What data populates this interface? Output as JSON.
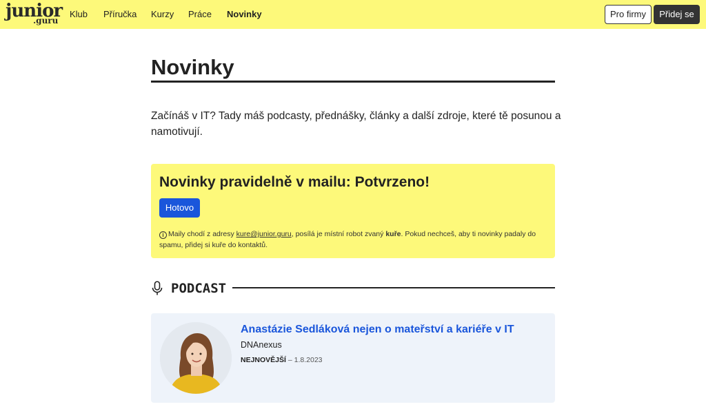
{
  "logo": {
    "line1": "junior",
    "line2": ".guru"
  },
  "nav": {
    "links": [
      "Klub",
      "Příručka",
      "Kurzy",
      "Práce",
      "Novinky"
    ],
    "active": "Novinky",
    "for_companies": "Pro firmy",
    "join": "Přidej se"
  },
  "page": {
    "title": "Novinky",
    "intro": "Začínáš v IT? Tady máš podcasty, přednášky, články a další zdroje, které tě posunou a namotivují."
  },
  "subscribe": {
    "heading": "Novinky pravidelně v mailu: Potvrzeno!",
    "button": "Hotovo",
    "note_icon": "i",
    "note_prefix": "Maily chodí z adresy ",
    "note_email": "kure@junior.guru",
    "note_mid": ", posílá je místní robot zvaný ",
    "note_bold": "kuře",
    "note_suffix": ". Pokud nechceš, aby ti novinky padaly do spamu, přidej si kuře do kontaktů."
  },
  "podcast": {
    "section_title": "PODCAST",
    "card": {
      "title": "Anastázie Sedláková nejen o mateřství a kariéře v IT",
      "subtitle": "DNAnexus",
      "badge": "NEJNOVĚJŠÍ",
      "date_sep": " – ",
      "date": "1.8.2023"
    }
  },
  "colors": {
    "nav_bg": "#fdf97a",
    "accent_blue": "#1a56db",
    "card_bg": "#eef3fa",
    "dark": "#333333"
  },
  "icons": {
    "section": "microphone-icon",
    "note": "info-icon"
  }
}
